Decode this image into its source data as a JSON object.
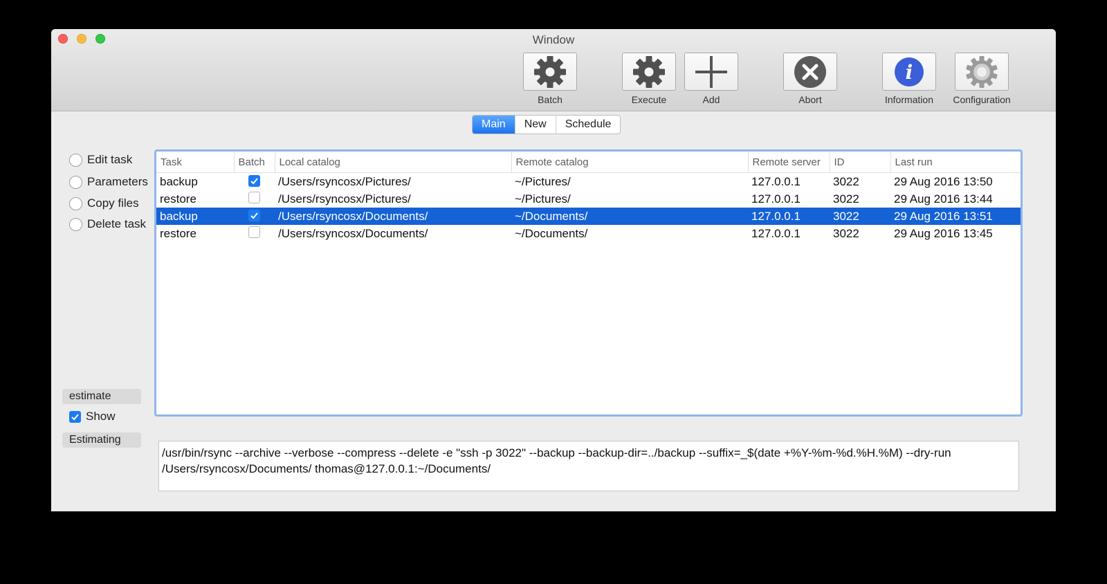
{
  "window": {
    "title": "Window"
  },
  "toolbar": {
    "batch": "Batch",
    "execute": "Execute",
    "add": "Add",
    "abort": "Abort",
    "information": "Information",
    "configuration": "Configuration"
  },
  "tabs": [
    {
      "label": "Main",
      "active": true
    },
    {
      "label": "New",
      "active": false
    },
    {
      "label": "Schedule",
      "active": false
    }
  ],
  "sidebar": {
    "options": [
      {
        "label": "Edit task"
      },
      {
        "label": "Parameters"
      },
      {
        "label": "Copy files"
      },
      {
        "label": "Delete task"
      }
    ],
    "estimate_label": "estimate",
    "show_label": "Show",
    "show_checked": true,
    "estimating_label": "Estimating"
  },
  "table": {
    "columns": [
      "Task",
      "Batch",
      "Local catalog",
      "Remote catalog",
      "Remote server",
      "ID",
      "Last run"
    ],
    "rows": [
      {
        "task": "backup",
        "batch": true,
        "local": "/Users/rsyncosx/Pictures/",
        "remote": "~/Pictures/",
        "server": "127.0.0.1",
        "id": "3022",
        "last_run": "29 Aug 2016 13:50",
        "selected": false
      },
      {
        "task": "restore",
        "batch": false,
        "local": "/Users/rsyncosx/Pictures/",
        "remote": "~/Pictures/",
        "server": "127.0.0.1",
        "id": "3022",
        "last_run": "29 Aug 2016 13:44",
        "selected": false
      },
      {
        "task": "backup",
        "batch": true,
        "local": "/Users/rsyncosx/Documents/",
        "remote": "~/Documents/",
        "server": "127.0.0.1",
        "id": "3022",
        "last_run": "29 Aug 2016 13:51",
        "selected": true
      },
      {
        "task": "restore",
        "batch": false,
        "local": "/Users/rsyncosx/Documents/",
        "remote": "~/Documents/",
        "server": "127.0.0.1",
        "id": "3022",
        "last_run": "29 Aug 2016 13:45",
        "selected": false
      }
    ]
  },
  "command": "/usr/bin/rsync --archive --verbose --compress --delete -e  \"ssh -p 3022\"  --backup --backup-dir=../backup --suffix=_$(date +%Y-%m-%d.%H.%M) --dry-run /Users/rsyncosx/Documents/ thomas@127.0.0.1:~/Documents/",
  "icons": {
    "batch": "gear-icon",
    "execute": "gear-icon",
    "add": "plus-icon",
    "abort": "x-circle-icon",
    "information": "info-icon",
    "configuration": "gear-outline-icon"
  },
  "colors": {
    "accent": "#1d73ee",
    "selection": "#1562d6",
    "info": "#3a5fd8"
  }
}
